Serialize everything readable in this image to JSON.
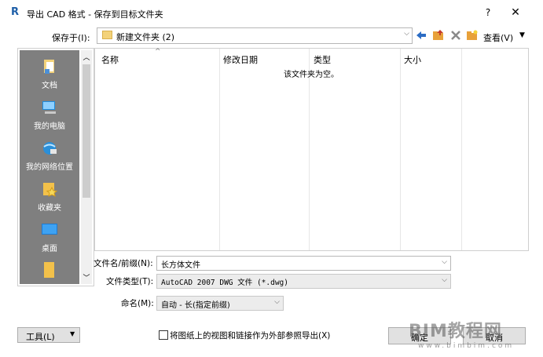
{
  "titlebar": {
    "app_icon": "R",
    "title": "导出 CAD 格式 - 保存到目标文件夹",
    "help": "?",
    "close": "✕"
  },
  "location": {
    "label": "保存于(I):",
    "path": "新建文件夹 (2)"
  },
  "toolbar": {
    "icons": [
      "back-arrow-icon",
      "up-folder-icon",
      "delete-icon",
      "new-folder-icon"
    ],
    "views_label": "查看(V)"
  },
  "places": [
    {
      "name": "文档",
      "icon": "documents-icon"
    },
    {
      "name": "我的电脑",
      "icon": "computer-icon"
    },
    {
      "name": "我的网络位置",
      "icon": "network-icon"
    },
    {
      "name": "收藏夹",
      "icon": "favorites-icon"
    },
    {
      "name": "桌面",
      "icon": "desktop-icon"
    },
    {
      "name": "",
      "icon": "folder-icon"
    }
  ],
  "filelist": {
    "columns": [
      "名称",
      "修改日期",
      "类型",
      "大小"
    ],
    "empty_message": "该文件夹为空。"
  },
  "form": {
    "filename_label": "文件名/前缀(N):",
    "filename_value": "长方体文件",
    "filetype_label": "文件类型(T):",
    "filetype_value": "AutoCAD 2007 DWG 文件 (*.dwg)",
    "naming_label": "命名(M):",
    "naming_value": "自动 - 长(指定前缀)"
  },
  "bottom": {
    "tools_label": "工具(L)",
    "export_xref_label": "将图纸上的视图和链接作为外部参照导出(X)",
    "ok_label": "确定",
    "cancel_label": "取消"
  },
  "watermark": {
    "text": "BIM教程网",
    "url": "www.bimbim.com"
  },
  "colors": {
    "places_bg": "#7f7f7f",
    "folder_yellow": "#f3d27a",
    "app_icon_blue": "#1e5fa8"
  }
}
